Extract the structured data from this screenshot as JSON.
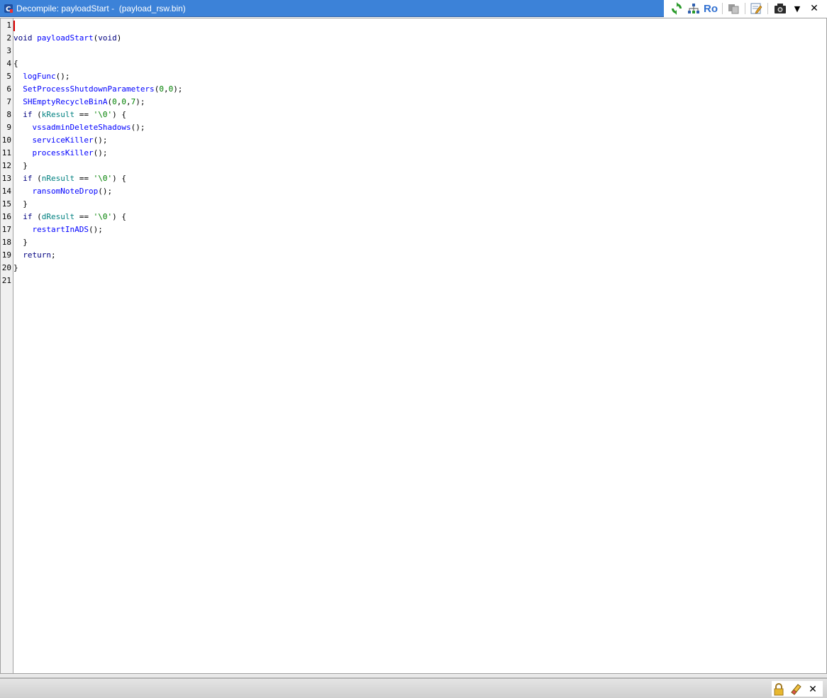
{
  "window": {
    "title": "Decompile: payloadStart -  (payload_rsw.bin)",
    "accent": "#3c82d8"
  },
  "toolbar": {
    "icons": [
      "refresh-icon",
      "graph-icon",
      "read-only-toggle",
      "copy-icon",
      "edit-icon",
      "snapshot-icon",
      "dropdown-icon",
      "close-icon"
    ],
    "ro_label": "Ro",
    "close_label": "✕",
    "dropdown_label": "▼"
  },
  "code": {
    "lines": [
      {
        "n": "1"
      },
      {
        "n": "2",
        "parts": [
          {
            "t": "void",
            "c": "kw"
          },
          {
            "t": " "
          },
          {
            "t": "payloadStart",
            "c": "fn"
          },
          {
            "t": "("
          },
          {
            "t": "void",
            "c": "kw"
          },
          {
            "t": ")"
          }
        ]
      },
      {
        "n": "3"
      },
      {
        "n": "4",
        "parts": [
          {
            "t": "{"
          }
        ]
      },
      {
        "n": "5",
        "parts": [
          {
            "t": "  "
          },
          {
            "t": "logFunc",
            "c": "fn"
          },
          {
            "t": "();"
          }
        ]
      },
      {
        "n": "6",
        "parts": [
          {
            "t": "  "
          },
          {
            "t": "SetProcessShutdownParameters",
            "c": "fn"
          },
          {
            "t": "("
          },
          {
            "t": "0",
            "c": "num"
          },
          {
            "t": ","
          },
          {
            "t": "0",
            "c": "num"
          },
          {
            "t": ");"
          }
        ]
      },
      {
        "n": "7",
        "parts": [
          {
            "t": "  "
          },
          {
            "t": "SHEmptyRecycleBinA",
            "c": "fn"
          },
          {
            "t": "("
          },
          {
            "t": "0",
            "c": "num"
          },
          {
            "t": ","
          },
          {
            "t": "0",
            "c": "num"
          },
          {
            "t": ","
          },
          {
            "t": "7",
            "c": "num"
          },
          {
            "t": ");"
          }
        ]
      },
      {
        "n": "8",
        "parts": [
          {
            "t": "  "
          },
          {
            "t": "if",
            "c": "kw"
          },
          {
            "t": " ("
          },
          {
            "t": "kResult",
            "c": "var"
          },
          {
            "t": " == "
          },
          {
            "t": "'\\0'",
            "c": "str"
          },
          {
            "t": ") {"
          }
        ]
      },
      {
        "n": "9",
        "parts": [
          {
            "t": "    "
          },
          {
            "t": "vssadminDeleteShadows",
            "c": "fn"
          },
          {
            "t": "();"
          }
        ]
      },
      {
        "n": "10",
        "parts": [
          {
            "t": "    "
          },
          {
            "t": "serviceKiller",
            "c": "fn"
          },
          {
            "t": "();"
          }
        ]
      },
      {
        "n": "11",
        "parts": [
          {
            "t": "    "
          },
          {
            "t": "processKiller",
            "c": "fn"
          },
          {
            "t": "();"
          }
        ]
      },
      {
        "n": "12",
        "parts": [
          {
            "t": "  }"
          }
        ]
      },
      {
        "n": "13",
        "parts": [
          {
            "t": "  "
          },
          {
            "t": "if",
            "c": "kw"
          },
          {
            "t": " ("
          },
          {
            "t": "nResult",
            "c": "var"
          },
          {
            "t": " == "
          },
          {
            "t": "'\\0'",
            "c": "str"
          },
          {
            "t": ") {"
          }
        ]
      },
      {
        "n": "14",
        "parts": [
          {
            "t": "    "
          },
          {
            "t": "ransomNoteDrop",
            "c": "fn"
          },
          {
            "t": "();"
          }
        ]
      },
      {
        "n": "15",
        "parts": [
          {
            "t": "  }"
          }
        ]
      },
      {
        "n": "16",
        "parts": [
          {
            "t": "  "
          },
          {
            "t": "if",
            "c": "kw"
          },
          {
            "t": " ("
          },
          {
            "t": "dResult",
            "c": "var"
          },
          {
            "t": " == "
          },
          {
            "t": "'\\0'",
            "c": "str"
          },
          {
            "t": ") {"
          }
        ]
      },
      {
        "n": "17",
        "parts": [
          {
            "t": "    "
          },
          {
            "t": "restartInADS",
            "c": "fn"
          },
          {
            "t": "();"
          }
        ]
      },
      {
        "n": "18",
        "parts": [
          {
            "t": "  }"
          }
        ]
      },
      {
        "n": "19",
        "parts": [
          {
            "t": "  "
          },
          {
            "t": "return",
            "c": "kw"
          },
          {
            "t": ";"
          }
        ]
      },
      {
        "n": "20",
        "parts": [
          {
            "t": "}"
          }
        ]
      },
      {
        "n": "21"
      }
    ]
  },
  "statusbar": {
    "icons": [
      "lock-icon",
      "eraser-icon",
      "close-icon"
    ],
    "close_label": "✕"
  }
}
